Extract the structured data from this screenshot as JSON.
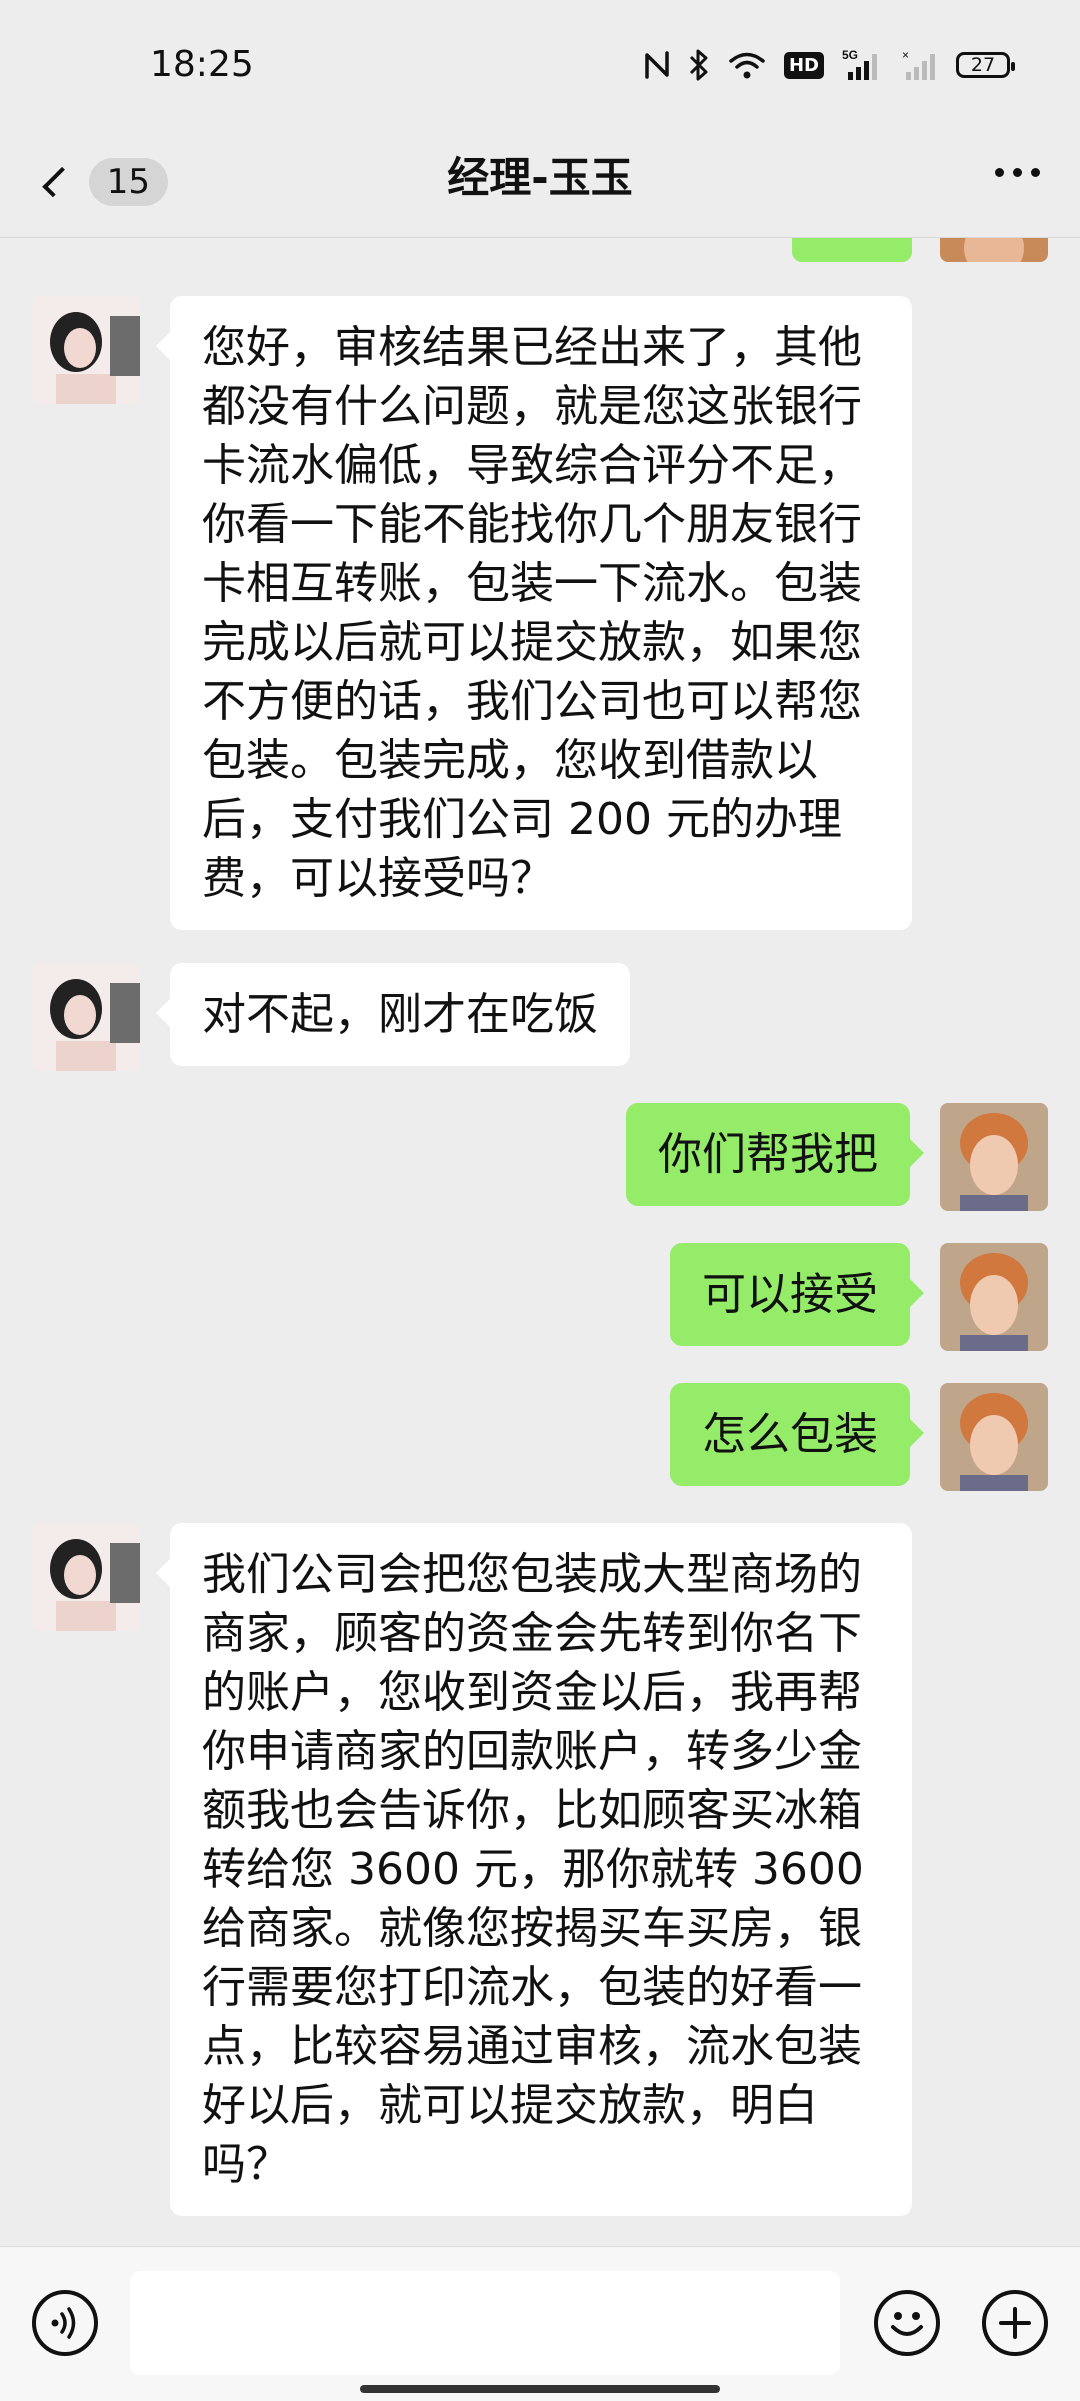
{
  "status_bar": {
    "time": "18:25",
    "battery": "27",
    "hd_label": "HD",
    "network_label": "5G"
  },
  "header": {
    "back_count": "15",
    "title": "经理-玉玉"
  },
  "messages": [
    {
      "from": "contact",
      "text": "您好，审核结果已经出来了，其他都没有什么问题，就是您这张银行卡流水偏低，导致综合评分不足，你看一下能不能找你几个朋友银行卡相互转账，包装一下流水。包装完成以后就可以提交放款，如果您不方便的话，我们公司也可以帮您包装。包装完成，您收到借款以后，支付我们公司 200 元的办理费，可以接受吗？"
    },
    {
      "from": "contact",
      "text": "对不起，刚才在吃饭"
    },
    {
      "from": "me",
      "text": "你们帮我把"
    },
    {
      "from": "me",
      "text": "可以接受"
    },
    {
      "from": "me",
      "text": "怎么包装"
    },
    {
      "from": "contact",
      "text": "我们公司会把您包装成大型商场的商家，顾客的资金会先转到你名下的账户，您收到资金以后，我再帮你申请商家的回款账户，转多少金额我也会告诉你，比如顾客买冰箱转给您 3600 元，那你就转 3600 给商家。就像您按揭买车买房，银行需要您打印流水，包装的好看一点，比较容易通过审核，流水包装好以后，就可以提交放款，明白吗？"
    }
  ],
  "input": {
    "value": "",
    "placeholder": ""
  },
  "colors": {
    "background": "#ededed",
    "incoming_bubble": "#ffffff",
    "outgoing_bubble": "#95ec69",
    "bottom_bar": "#f7f7f7"
  }
}
